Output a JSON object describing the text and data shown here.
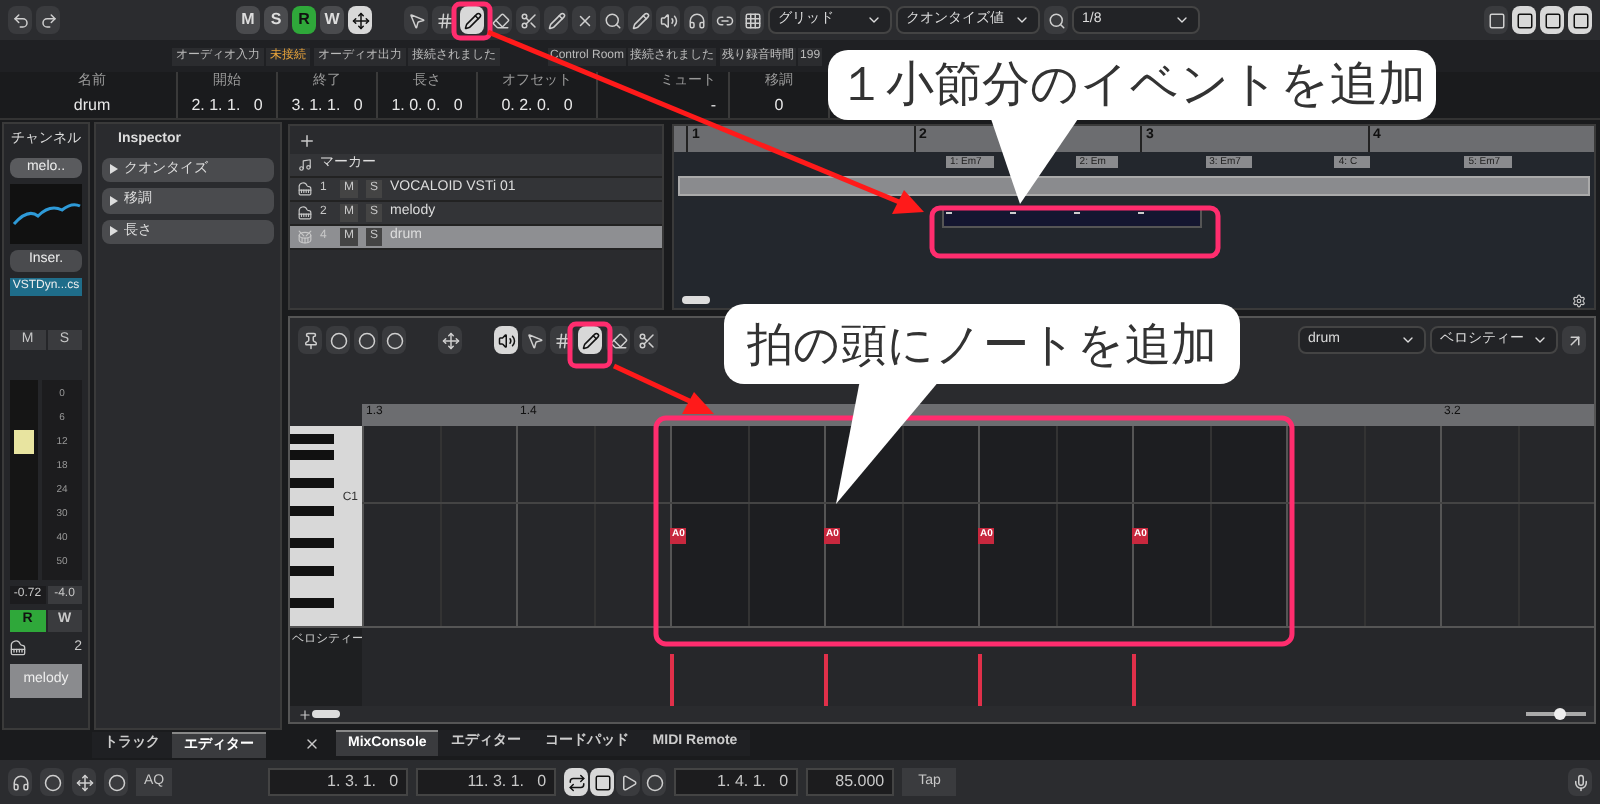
{
  "toolbar": {
    "msrw": [
      {
        "label": "M",
        "on": false
      },
      {
        "label": "S",
        "on": false
      },
      {
        "label": "R",
        "on": true
      },
      {
        "label": "W",
        "on": false
      }
    ],
    "snap_mode": "グリッド",
    "quantize_type": "クオンタイズ値",
    "quantize_value": "1/8"
  },
  "status_row": [
    {
      "label": "オーディオ入力",
      "value": "未接続",
      "connected": false
    },
    {
      "label": "オーディオ出力",
      "value": "接続されました",
      "connected": true
    },
    {
      "label": "Control Room",
      "value": "接続されました",
      "connected": true
    },
    {
      "label": "残り録音時間",
      "value": "199",
      "connected": true
    }
  ],
  "info_line": [
    {
      "label": "名前",
      "value": "drum"
    },
    {
      "label": "開始",
      "value": "2. 1. 1.   0"
    },
    {
      "label": "終了",
      "value": "3. 1. 1.   0"
    },
    {
      "label": "長さ",
      "value": "1. 0. 0.   0"
    },
    {
      "label": "オフセット",
      "value": "0. 2. 0.   0"
    },
    {
      "label": "ミュート",
      "value": "-"
    },
    {
      "label": "移調",
      "value": "0"
    }
  ],
  "channel": {
    "title": "チャンネル",
    "name": "melo..",
    "insert_label": "Inser.",
    "plugin": "VSTDyn...cs",
    "mute": "M",
    "solo": "S",
    "level": 0.72,
    "fader_scale": [
      "0",
      "6",
      "12",
      "18",
      "24",
      "30",
      "40",
      "50"
    ],
    "volume": "-0.72",
    "pan": "-4.0",
    "read": {
      "label": "R",
      "on": true
    },
    "write": {
      "label": "W",
      "on": false
    },
    "number": "2",
    "track_name": "melody"
  },
  "inspector": {
    "title": "Inspector",
    "sections": [
      "クオンタイズ",
      "移調",
      "長さ"
    ]
  },
  "tracks": [
    {
      "kind": "marker",
      "name": "マーカー",
      "selected": false
    },
    {
      "kind": "instrument",
      "number": "1",
      "mute": "M",
      "solo": "S",
      "name": "VOCALOID VSTi 01",
      "selected": false
    },
    {
      "kind": "instrument",
      "number": "2",
      "mute": "M",
      "solo": "S",
      "name": "melody",
      "selected": false
    },
    {
      "kind": "drum",
      "number": "4",
      "mute": "M",
      "solo": "S",
      "name": "drum",
      "selected": true
    }
  ],
  "arrangement": {
    "bars": [
      "1",
      "2",
      "3",
      "4"
    ],
    "chords": [
      "1: Em7",
      "2: Em",
      "3: Em7",
      "4: C",
      "5: Em7"
    ]
  },
  "editor": {
    "part": "drum",
    "controller": "ベロシティー",
    "ruler": [
      "1.3",
      "1.4",
      "3.2"
    ],
    "key_label": "C1",
    "lane_label": "ベロシティー",
    "notes": [
      "A0",
      "A0",
      "A0",
      "A0"
    ],
    "zoom": {
      "level": 0.6
    }
  },
  "left_tabs": [
    {
      "label": "トラック",
      "selected": false
    },
    {
      "label": "エディター",
      "selected": true
    }
  ],
  "bottom_tabs": [
    {
      "label": "MixConsole",
      "selected": true
    },
    {
      "label": "エディター",
      "selected": false
    },
    {
      "label": "コードパッド",
      "selected": false
    },
    {
      "label": "MIDI Remote",
      "selected": false
    }
  ],
  "transport": {
    "aq": "AQ",
    "left_locator": "1. 3. 1.   0",
    "right_locator": "11. 3. 1.   0",
    "position": "1. 4. 1.   0",
    "tempo": "85.000",
    "tap": "Tap"
  },
  "callouts": [
    "１小節分のイベントを追加",
    "拍の頭にノートを追加"
  ]
}
